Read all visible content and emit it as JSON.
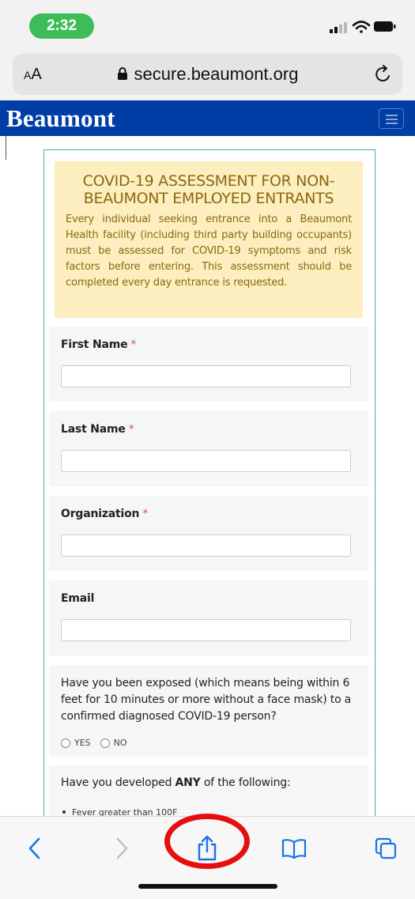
{
  "status_bar": {
    "time": "2:32"
  },
  "browser": {
    "text_size_label_small": "A",
    "text_size_label_large": "A",
    "url": "secure.beaumont.org",
    "icons": [
      "lock-icon",
      "reload-icon",
      "signal-icon",
      "wifi-icon",
      "battery-icon"
    ]
  },
  "site": {
    "brand": "Beaumont",
    "brand_color": "#003da5"
  },
  "notice": {
    "title": "COVID-19 ASSESSMENT FOR NON-BEAUMONT EMPLOYED ENTRANTS",
    "body": "Every individual seeking entrance into a Beaumont Health facility (including third party building occupants) must be assessed for COVID-19 symptoms and risk factors before entering. This assessment should be completed every day entrance is requested.",
    "background": "#fdeec0",
    "text_color": "#8a6a10"
  },
  "form": {
    "first_name": {
      "label": "First Name",
      "required_mark": "*",
      "value": ""
    },
    "last_name": {
      "label": "Last Name",
      "required_mark": "*",
      "value": ""
    },
    "organization": {
      "label": "Organization",
      "required_mark": "*",
      "value": ""
    },
    "email": {
      "label": "Email",
      "value": ""
    },
    "exposure_question": {
      "text": "Have you been exposed (which means being within 6 feet for 10 minutes or more without a face mask) to a confirmed diagnosed COVID-19 person?",
      "options": [
        "YES",
        "NO"
      ]
    },
    "symptoms_question": {
      "prefix": "Have you developed ",
      "emphasis": "ANY",
      "suffix": " of the following:",
      "items": [
        "Fever greater than 100F"
      ]
    }
  },
  "toolbar": {
    "icons": [
      "back-icon",
      "forward-icon",
      "share-icon",
      "bookmarks-icon",
      "tabs-icon"
    ],
    "highlight_color": "#e60f0f",
    "accent": "#1a73e8"
  }
}
